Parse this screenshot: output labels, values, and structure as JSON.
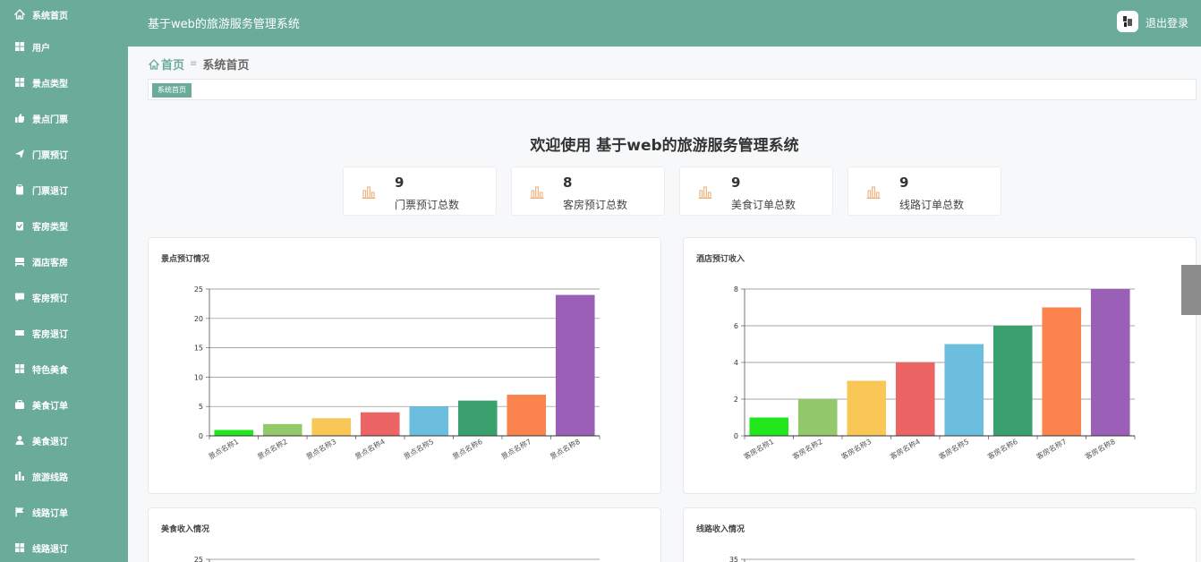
{
  "sidebar": {
    "items": [
      {
        "label": "系统首页",
        "icon": "home-icon"
      },
      {
        "label": "用户",
        "icon": "grid-icon"
      },
      {
        "label": "景点类型",
        "icon": "grid-icon"
      },
      {
        "label": "景点门票",
        "icon": "thumbs-up-icon"
      },
      {
        "label": "门票预订",
        "icon": "send-icon"
      },
      {
        "label": "门票退订",
        "icon": "clipboard-icon"
      },
      {
        "label": "客房类型",
        "icon": "clipboard-check-icon"
      },
      {
        "label": "酒店客房",
        "icon": "bed-icon"
      },
      {
        "label": "客房预订",
        "icon": "comment-icon"
      },
      {
        "label": "客房退订",
        "icon": "ticket-icon"
      },
      {
        "label": "特色美食",
        "icon": "grid-icon"
      },
      {
        "label": "美食订单",
        "icon": "briefcase-icon"
      },
      {
        "label": "美食退订",
        "icon": "user-icon"
      },
      {
        "label": "旅游线路",
        "icon": "bar-chart-icon"
      },
      {
        "label": "线路订单",
        "icon": "flag-icon"
      },
      {
        "label": "线路退订",
        "icon": "grid-icon"
      }
    ]
  },
  "header": {
    "title": "基于web的旅游服务管理系统",
    "logout": "退出登录"
  },
  "breadcrumb": {
    "home": "首页",
    "separator": "≡",
    "current": "系统首页"
  },
  "tabs": [
    {
      "label": "系统首页"
    }
  ],
  "welcome": "欢迎使用 基于web的旅游服务管理系统",
  "stats": [
    {
      "value": "9",
      "label": "门票预订总数"
    },
    {
      "value": "8",
      "label": "客房预订总数"
    },
    {
      "value": "9",
      "label": "美食订单总数"
    },
    {
      "value": "9",
      "label": "线路订单总数"
    }
  ],
  "colors": {
    "accent": "#6aac99",
    "palette": [
      "#22e71f",
      "#93c96b",
      "#f8c755",
      "#ed6464",
      "#6cbedf",
      "#39a06e",
      "#fb834d",
      "#9b5fb7"
    ]
  },
  "chart_data": [
    {
      "type": "bar",
      "title": "景点预订情况",
      "categories": [
        "景点名称1",
        "景点名称2",
        "景点名称3",
        "景点名称4",
        "景点名称5",
        "景点名称6",
        "景点名称7",
        "景点名称8"
      ],
      "values": [
        1,
        2,
        3,
        4,
        5,
        6,
        7,
        24
      ],
      "ylim": [
        0,
        25
      ],
      "yticks": [
        0,
        5,
        10,
        15,
        20,
        25
      ],
      "grid": true
    },
    {
      "type": "bar",
      "title": "酒店预订收入",
      "categories": [
        "客房名称1",
        "客房名称2",
        "客房名称3",
        "客房名称4",
        "客房名称5",
        "客房名称6",
        "客房名称7",
        "客房名称8"
      ],
      "values": [
        1,
        2,
        3,
        4,
        5,
        6,
        7,
        8
      ],
      "ylim": [
        0,
        8
      ],
      "yticks": [
        0,
        2,
        4,
        6,
        8
      ],
      "grid": true
    },
    {
      "type": "bar",
      "title": "美食收入情况",
      "categories": [],
      "values": [],
      "ylim": [
        0,
        25
      ],
      "yticks": [
        25
      ],
      "grid": true
    },
    {
      "type": "bar",
      "title": "线路收入情况",
      "categories": [],
      "values": [],
      "ylim": [
        0,
        35
      ],
      "yticks": [
        35
      ],
      "grid": true
    }
  ]
}
